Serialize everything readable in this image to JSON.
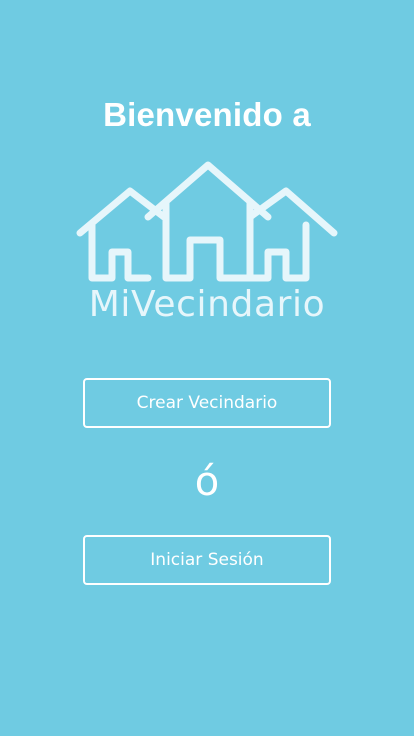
{
  "welcome": {
    "title": "Bienvenido a"
  },
  "logo": {
    "icon": "houses-icon",
    "text": "MiVecindario"
  },
  "actions": {
    "create_label": "Crear Vecindario",
    "separator": "ó",
    "login_label": "Iniciar Sesión"
  },
  "colors": {
    "background": "#6fcbe2",
    "foreground": "#ffffff",
    "logo": "#e6f6fb"
  }
}
